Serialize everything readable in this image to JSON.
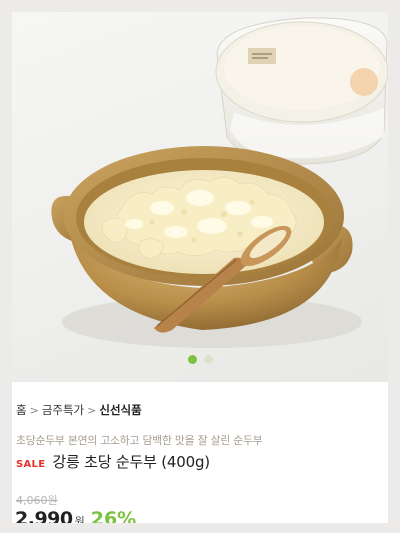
{
  "hero": {
    "image_alt": "강릉 초당 순두부",
    "package_label": "초당 순두부",
    "package_weight": "400g"
  },
  "carousel": {
    "total": 2,
    "active": 1
  },
  "breadcrumb": {
    "items": [
      "홈",
      "금주특가",
      "신선식품"
    ],
    "separator": ">"
  },
  "product": {
    "subtitle": "초당순두부 본연의 고소하고 담백한 맛을 잘 살린 순두부",
    "badge": "SALE",
    "name": "강릉 초당 순두부 (400g)",
    "original_price": "4,060원",
    "price": "2,990",
    "currency": "원",
    "discount": "26%"
  },
  "colors": {
    "accent": "#7cc241",
    "sale": "#e4332a",
    "subtitle": "#a79d90"
  }
}
